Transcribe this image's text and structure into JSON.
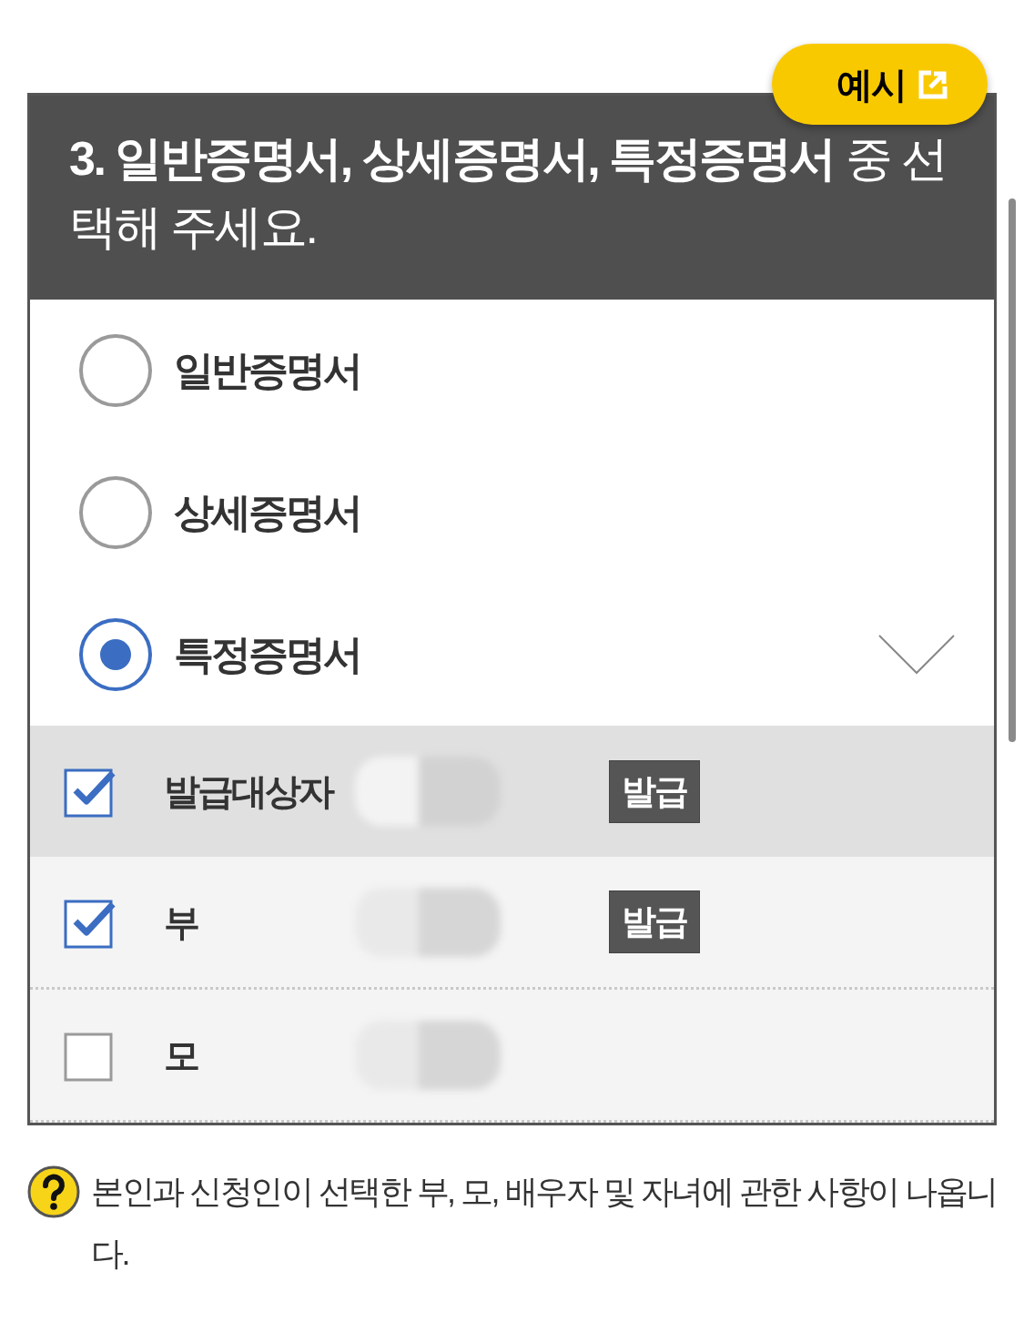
{
  "example_button": {
    "label": "예시"
  },
  "question": {
    "title": "**3. 일반증명서, 상세증명서, 특정증명서** 중 선택해 주세요."
  },
  "options": [
    {
      "label": "일반증명서",
      "selected": false,
      "expanded": false
    },
    {
      "label": "상세증명서",
      "selected": false,
      "expanded": false
    },
    {
      "label": "특정증명서",
      "selected": true,
      "expanded": true,
      "persons": [
        {
          "label": "발급대상자",
          "checked": true,
          "highlighted": true,
          "action": "발급"
        },
        {
          "label": "부",
          "checked": true,
          "highlighted": false,
          "action": "발급"
        },
        {
          "label": "모",
          "checked": false,
          "highlighted": false
        }
      ]
    }
  ],
  "help": {
    "text": "본인과 신청인이 선택한 부, 모, 배우자 및 자녀에 관한 사항이 나옵니다."
  }
}
